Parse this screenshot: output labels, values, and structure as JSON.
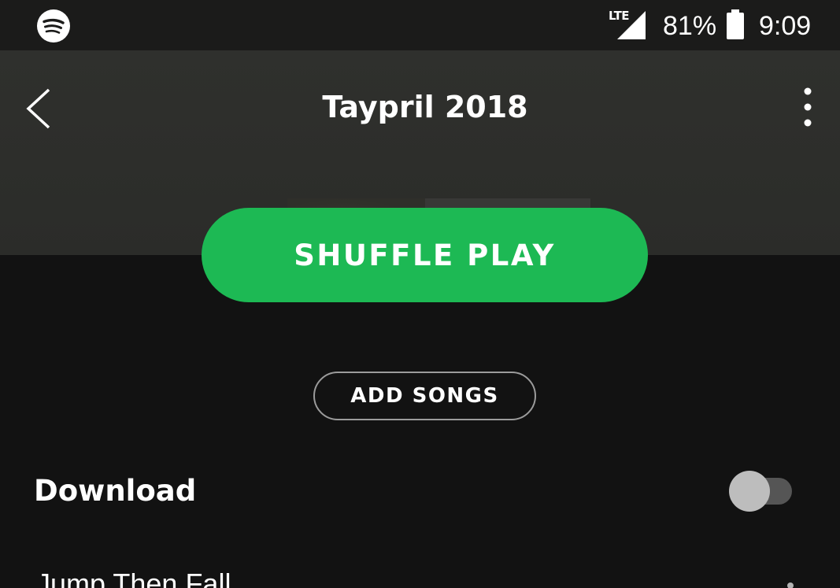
{
  "status_bar": {
    "network": "LTE",
    "battery_percent": "81%",
    "time": "9:09"
  },
  "header": {
    "title": "Taypril 2018",
    "back_icon": "chevron-left-icon",
    "more_icon": "vertical-dots-icon"
  },
  "actions": {
    "shuffle_play_label": "SHUFFLE PLAY",
    "add_songs_label": "ADD SONGS"
  },
  "download": {
    "label": "Download",
    "enabled": false
  },
  "tracks": [
    {
      "title": "Jump Then Fall"
    }
  ],
  "colors": {
    "accent": "#1db954",
    "background": "#121212",
    "header_background": "#2e2f2c",
    "status_bar": "#1b1b1a"
  }
}
